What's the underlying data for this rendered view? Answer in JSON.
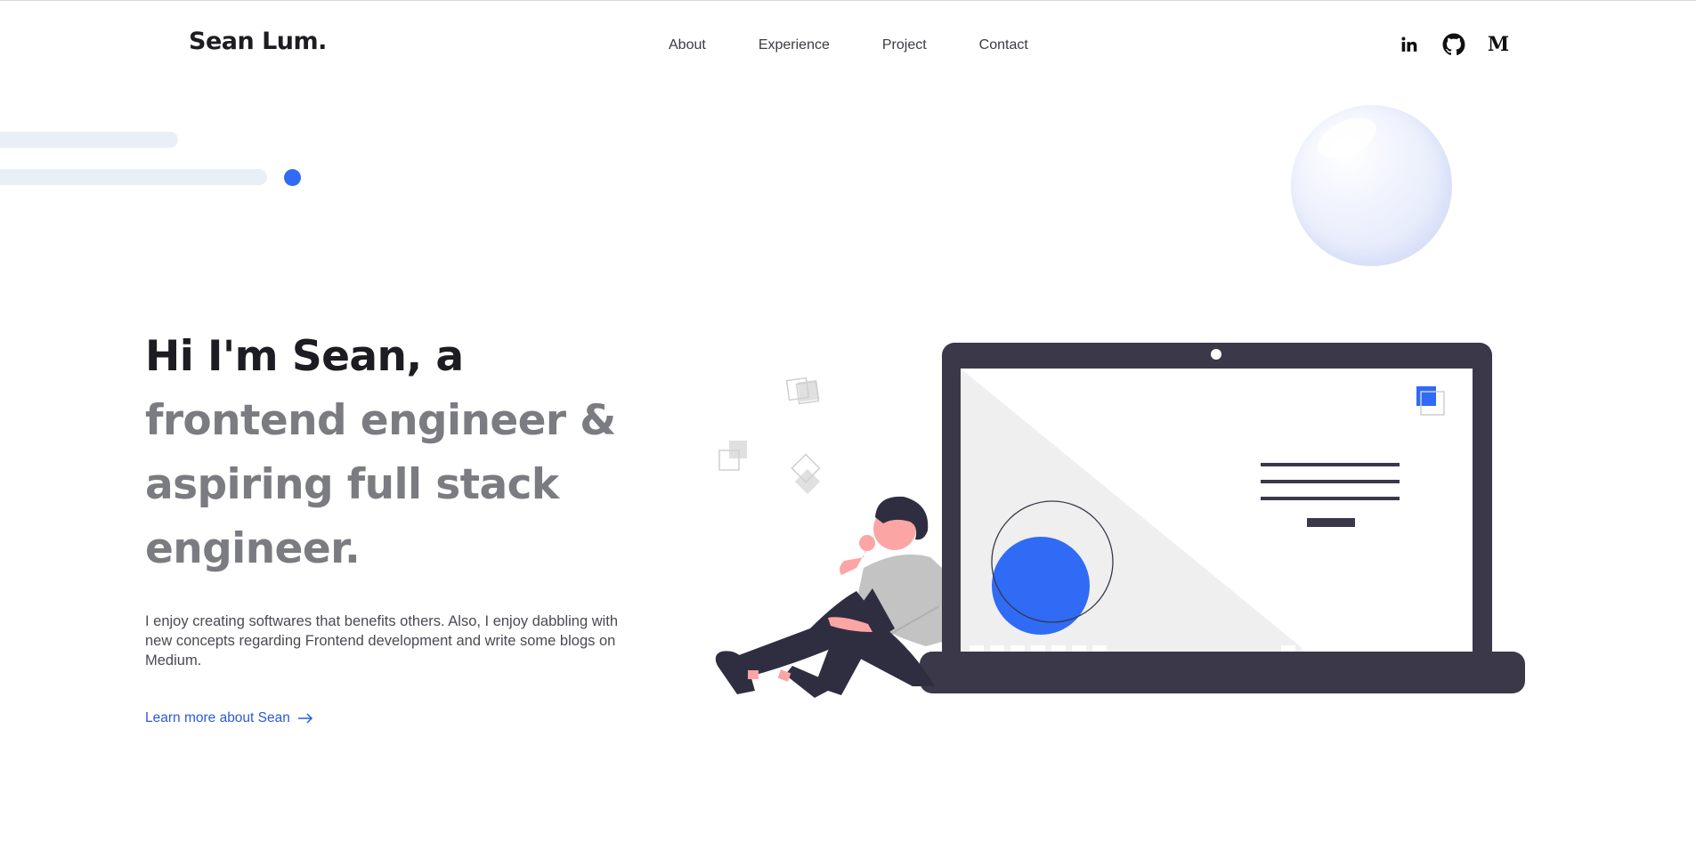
{
  "header": {
    "logo": "Sean Lum.",
    "nav": [
      "About",
      "Experience",
      "Project",
      "Contact"
    ],
    "socials": [
      {
        "name": "linkedin-icon",
        "label": "in"
      },
      {
        "name": "github-icon"
      },
      {
        "name": "medium-icon",
        "label": "M"
      }
    ]
  },
  "hero": {
    "title_line1": "Hi I'm Sean, a",
    "title_line2": "frontend engineer &",
    "title_line3": "aspiring full stack",
    "title_line4": "engineer.",
    "description": "I enjoy creating softwares that benefits others. Also, I enjoy dabbling with new concepts regarding Frontend development and write some blogs on Medium.",
    "link": "Learn more about Sean"
  },
  "colors": {
    "accent": "#2f6bf5",
    "dark": "#1c1c22",
    "muted": "#7b7b82",
    "laptop": "#3a3849",
    "link": "#2a5bd7"
  }
}
